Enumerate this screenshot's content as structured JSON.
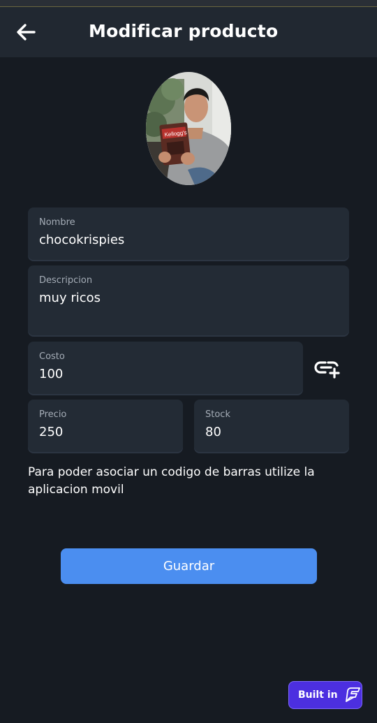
{
  "header": {
    "title": "Modificar producto",
    "back_icon": "arrow-left-icon"
  },
  "product_image": {
    "alt": "",
    "package_label": "Kellogg's"
  },
  "form": {
    "nombre": {
      "label": "Nombre",
      "value": "chocokrispies"
    },
    "descripcion": {
      "label": "Descripcion",
      "value": "muy ricos"
    },
    "costo": {
      "label": "Costo",
      "value": "100"
    },
    "precio": {
      "label": "Precio",
      "value": "250"
    },
    "stock": {
      "label": "Stock",
      "value": "80"
    },
    "link_icon": "add-link-icon"
  },
  "note": "Para poder asociar un codigo de barras utilize la aplicacion movil",
  "save_label": "Guardar",
  "badge": {
    "label": "Built in",
    "icon": "flutterflow-logo-icon"
  },
  "colors": {
    "background": "#161b22",
    "appbar": "#212831",
    "field": "#232b35",
    "primary_button": "#4b8ef0",
    "badge": "#4c2fe0"
  }
}
